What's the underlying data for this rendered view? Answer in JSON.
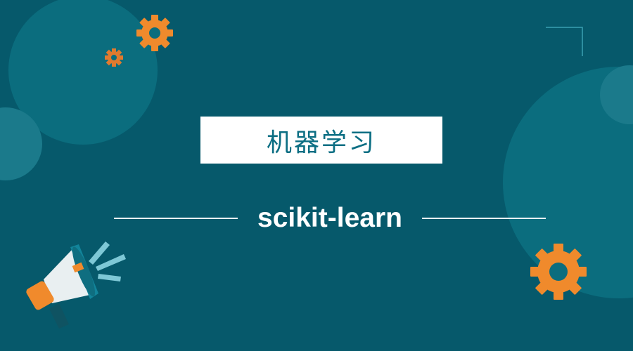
{
  "title": "机器学习",
  "subtitle": "scikit-learn",
  "colors": {
    "background": "#06596b",
    "circle": "#0b6d7e",
    "accent": "#f08a2c",
    "white": "#ffffff",
    "title_text": "#0b6e83"
  },
  "icons": [
    "gear-icon",
    "megaphone-icon"
  ]
}
